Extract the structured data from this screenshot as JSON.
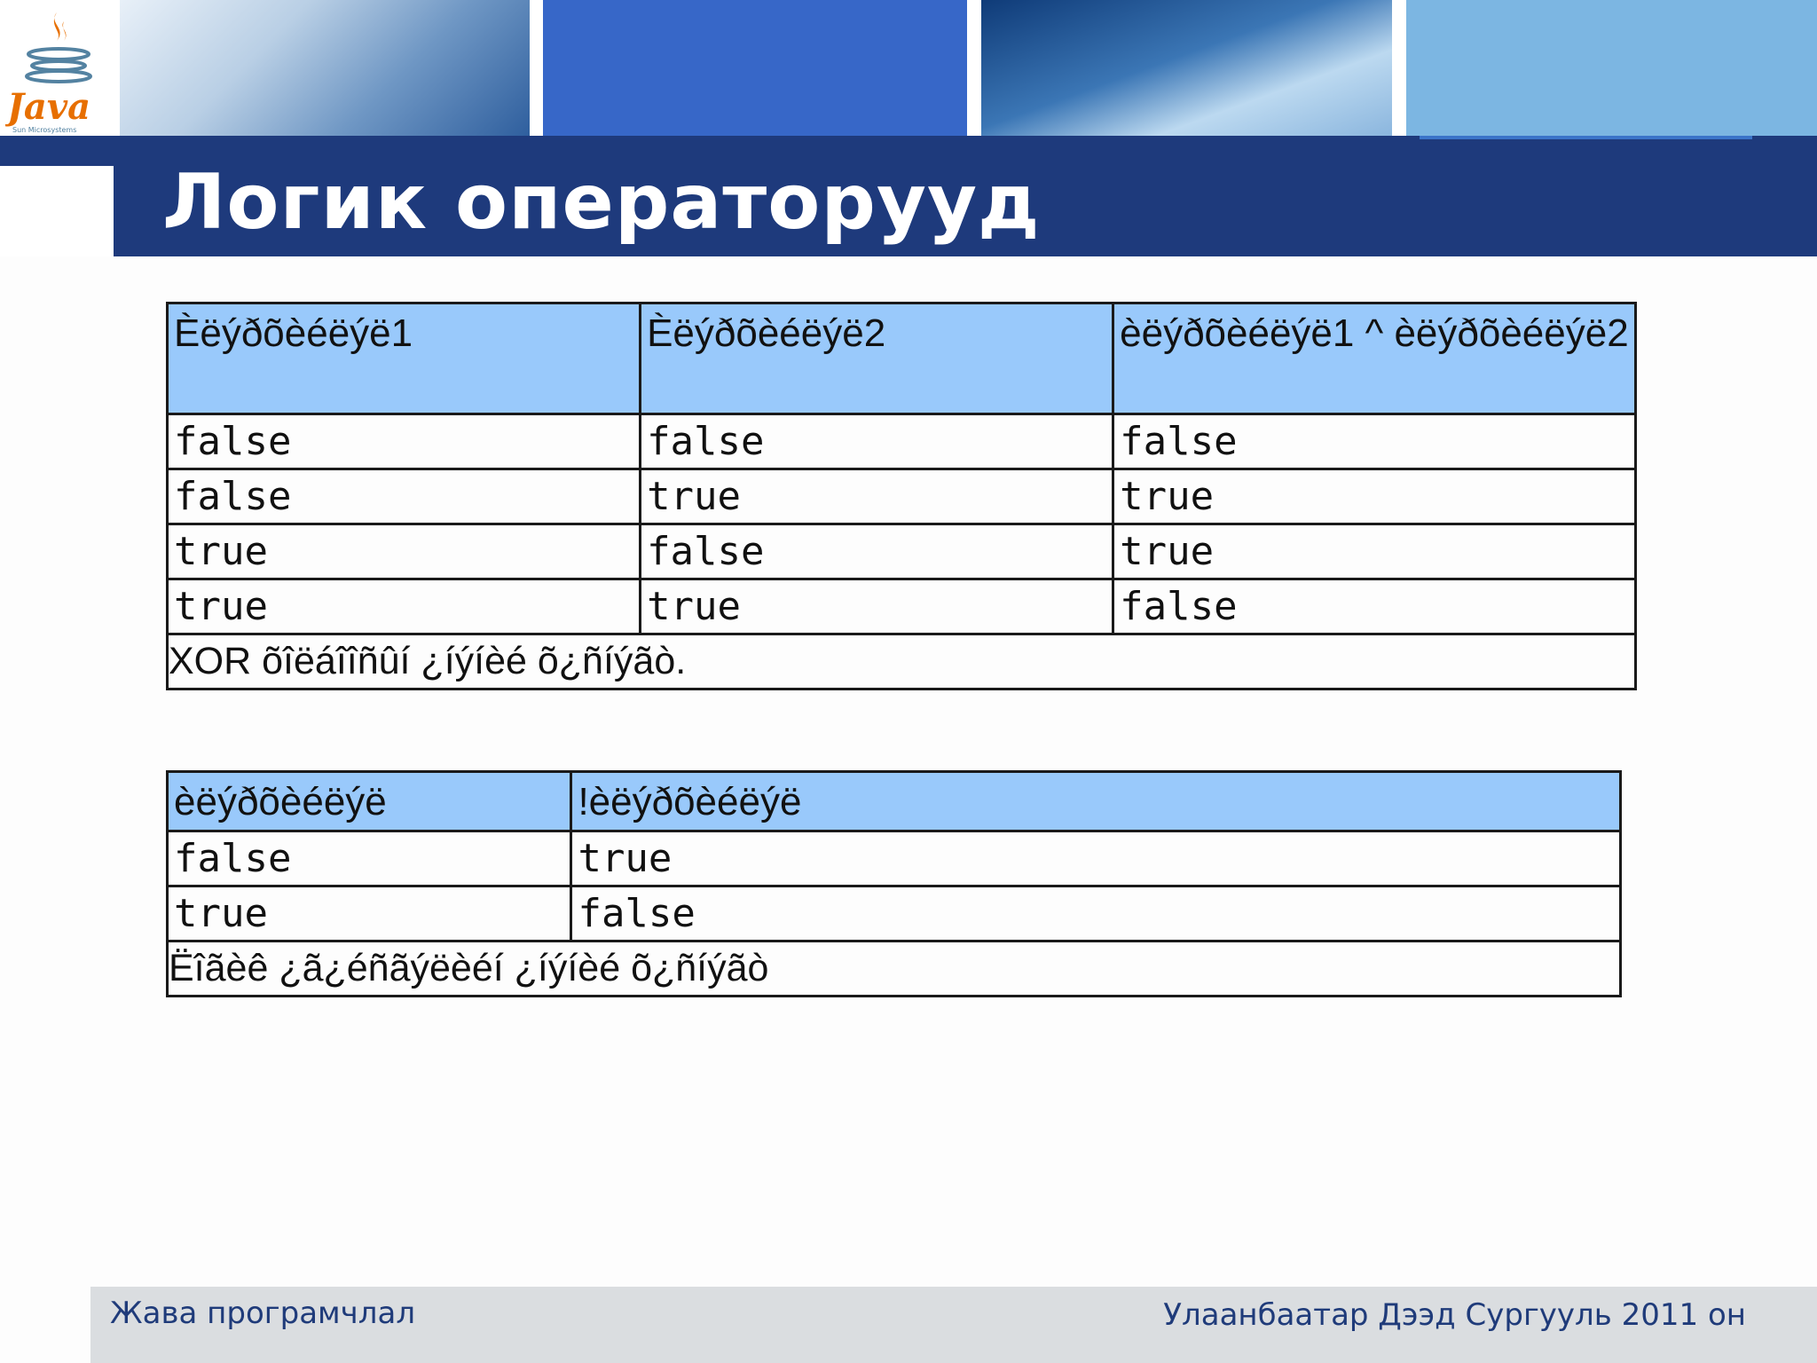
{
  "header": {
    "logo_text": "Java",
    "logo_subtext": "Sun Microsystems",
    "title": "Логик операторууд"
  },
  "xor_table": {
    "headers": [
      "Èëýðõèéëýë1",
      "Èëýðõèéëýë2",
      "èëýðõèéëýë1 ^ èëýðõèéëýë2"
    ],
    "rows": [
      [
        "false",
        "false",
        "false"
      ],
      [
        "false",
        "true",
        "true"
      ],
      [
        "true",
        "false",
        "true"
      ],
      [
        "true",
        "true",
        "false"
      ]
    ],
    "note": "XOR õîëáîîñûí ¿íýíèé õ¿ñíýãò."
  },
  "not_table": {
    "headers": [
      "èëýðõèéëýë",
      "!èëýðõèéëýë"
    ],
    "rows": [
      [
        "false",
        "true"
      ],
      [
        "true",
        "false"
      ]
    ],
    "note": "Ëîãèê ¿ã¿éñãýëèéí ¿íýíèé õ¿ñíýãò"
  },
  "footer": {
    "left": "Жава програмчлал",
    "right": "Улаанбаатар Дээд Сургууль 2011 он"
  },
  "colors": {
    "title_bar": "#1e3a7c",
    "table_header": "#99c9fb",
    "footer_bg": "#dadde0",
    "footer_text": "#1f3b7a"
  }
}
